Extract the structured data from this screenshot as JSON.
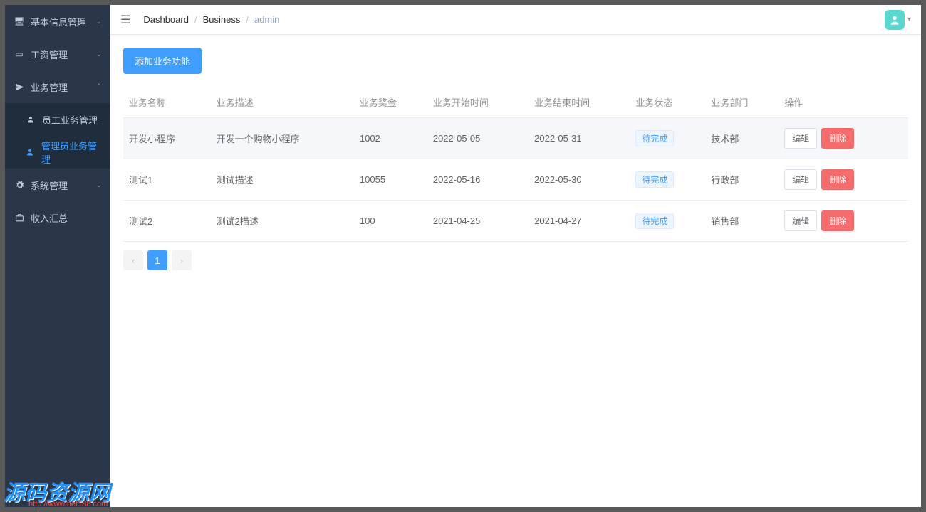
{
  "sidebar": {
    "items": [
      {
        "label": "基本信息管理",
        "icon": "monitor",
        "expanded": false
      },
      {
        "label": "工资管理",
        "icon": "id-card",
        "expanded": false
      },
      {
        "label": "业务管理",
        "icon": "send",
        "expanded": true,
        "children": [
          {
            "label": "员工业务管理",
            "icon": "user",
            "active": false
          },
          {
            "label": "管理员业务管理",
            "icon": "user-filled",
            "active": true
          }
        ]
      },
      {
        "label": "系统管理",
        "icon": "gear",
        "expanded": false
      },
      {
        "label": "收入汇总",
        "icon": "briefcase",
        "expanded": false
      }
    ]
  },
  "breadcrumbs": [
    "Dashboard",
    "Business",
    "admin"
  ],
  "toolbar": {
    "add_button": "添加业务功能"
  },
  "table": {
    "columns": [
      "业务名称",
      "业务描述",
      "业务奖金",
      "业务开始时间",
      "业务结束时间",
      "业务状态",
      "业务部门",
      "操作"
    ],
    "rows": [
      {
        "name": "开发小程序",
        "desc": "开发一个购物小程序",
        "bonus": "1002",
        "start": "2022-05-05",
        "end": "2022-05-31",
        "status": "待完成",
        "dept": "技术部"
      },
      {
        "name": "测试1",
        "desc": "测试描述",
        "bonus": "10055",
        "start": "2022-05-16",
        "end": "2022-05-30",
        "status": "待完成",
        "dept": "行政部"
      },
      {
        "name": "测试2",
        "desc": "测试2描述",
        "bonus": "100",
        "start": "2021-04-25",
        "end": "2021-04-27",
        "status": "待完成",
        "dept": "销售部"
      }
    ],
    "actions": {
      "edit": "编辑",
      "delete": "删除"
    }
  },
  "pagination": {
    "current": "1"
  },
  "watermark": {
    "title": "源码资源网",
    "url": "http://www.net188.com"
  }
}
